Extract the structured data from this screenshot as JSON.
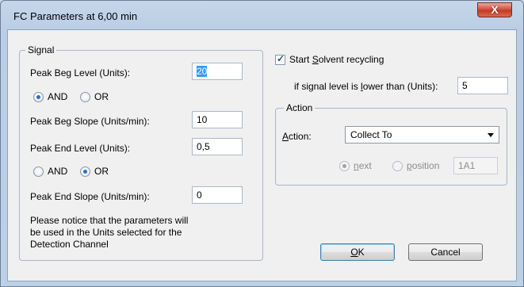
{
  "window": {
    "title": "FC Parameters at 6,00 min",
    "close_glyph": "X"
  },
  "signal": {
    "legend": "Signal",
    "peak_beg_level_label": "Peak Beg Level (Units):",
    "peak_beg_level_value": "20",
    "and_label": "AND",
    "or_label": "OR",
    "peak_beg_slope_label": "Peak Beg Slope (Units/min):",
    "peak_beg_slope_value": "10",
    "peak_end_level_label": "Peak End Level (Units):",
    "peak_end_level_value": "0,5",
    "and2_label": "AND",
    "or2_label": "OR",
    "peak_end_slope_label": "Peak End Slope (Units/min):",
    "peak_end_slope_value": "0",
    "notice_line1": "Please notice that the parameters will",
    "notice_line2": "be used in the Units selected for the",
    "notice_line3": "Detection Channel",
    "first_logic_selected": "AND",
    "second_logic_selected": "OR"
  },
  "recycling": {
    "start_pre": "Start ",
    "start_u": "S",
    "start_post": "olvent recycling",
    "start_checked": true,
    "threshold_pre": "if signal level is ",
    "threshold_u": "l",
    "threshold_post": "ower than (Units):",
    "threshold_value": "5"
  },
  "action": {
    "legend": "Action",
    "label_u": "A",
    "label_post": "ction:",
    "selected": "Collect To",
    "next_u": "n",
    "next_post": "ext",
    "position_u": "p",
    "position_post": "osition",
    "position_value": "1A1",
    "mode_selected": "next"
  },
  "buttons": {
    "ok_u": "O",
    "ok_post": "K",
    "cancel": "Cancel"
  }
}
